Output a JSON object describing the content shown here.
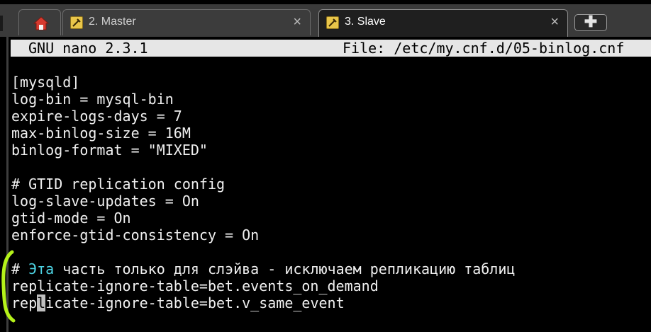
{
  "tabs": [
    {
      "label": "",
      "icon": "home-icon",
      "active": false
    },
    {
      "label": "2. Master",
      "icon": "putty-icon",
      "active": false
    },
    {
      "label": "3. Slave",
      "icon": "putty-icon",
      "active": true
    }
  ],
  "tab_close_glyph": "×",
  "add_tab_glyph": "✚",
  "editor": {
    "title_left": "GNU nano 2.3.1",
    "title_right": "File: /etc/my.cnf.d/05-binlog.cnf",
    "lines": [
      "[mysqld]",
      "log-bin = mysql-bin",
      "expire-logs-days = 7",
      "max-binlog-size = 16M",
      "binlog-format = \"MIXED\"",
      "# GTID replication config",
      "log-slave-updates = On",
      "gtid-mode = On",
      "enforce-gtid-consistency = On"
    ],
    "comment_prefix": "# ",
    "comment_highlight": "Эта",
    "comment_rest": " часть только для слэйва - исключаем репликацию таблиц",
    "ignore_line_1": "replicate-ignore-table=bet.events_on_demand",
    "ignore_line_2_before": "rep",
    "ignore_line_2_cursor": "l",
    "ignore_line_2_after": "icate-ignore-table=bet.v_same_event"
  },
  "colors": {
    "terminal_bg": "#000000",
    "text": "#f0f0f0",
    "keyword_cyan": "#4ed6e6",
    "title_bar_bg": "#e6e6e6",
    "annotation_green": "#b5f21a"
  }
}
